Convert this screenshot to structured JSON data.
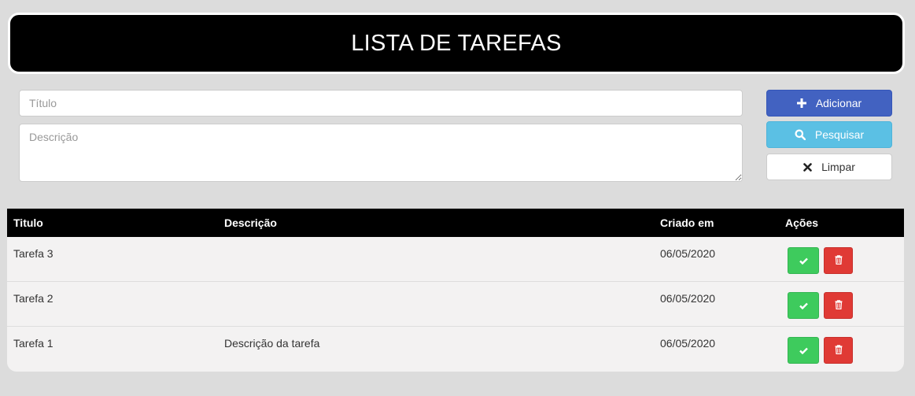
{
  "header": {
    "title": "LISTA DE TAREFAS"
  },
  "form": {
    "title_placeholder": "Título",
    "title_value": "",
    "description_placeholder": "Descrição",
    "description_value": ""
  },
  "buttons": {
    "add_label": "Adicionar",
    "search_label": "Pesquisar",
    "clear_label": "Limpar"
  },
  "table": {
    "columns": [
      "Titulo",
      "Descrição",
      "Criado em",
      "Ações"
    ],
    "rows": [
      {
        "title": "Tarefa 3",
        "description": "",
        "created": "06/05/2020"
      },
      {
        "title": "Tarefa 2",
        "description": "",
        "created": "06/05/2020"
      },
      {
        "title": "Tarefa 1",
        "description": "Descrição da tarefa",
        "created": "06/05/2020"
      }
    ]
  },
  "colors": {
    "add": "#4262c1",
    "search": "#5bc0e4",
    "complete": "#3ecb5d",
    "delete": "#e03a35",
    "header_bg": "#000000"
  },
  "icons": {
    "add": "plus-icon",
    "search": "search-icon",
    "clear": "close-icon",
    "complete": "check-icon",
    "delete": "trash-icon"
  }
}
